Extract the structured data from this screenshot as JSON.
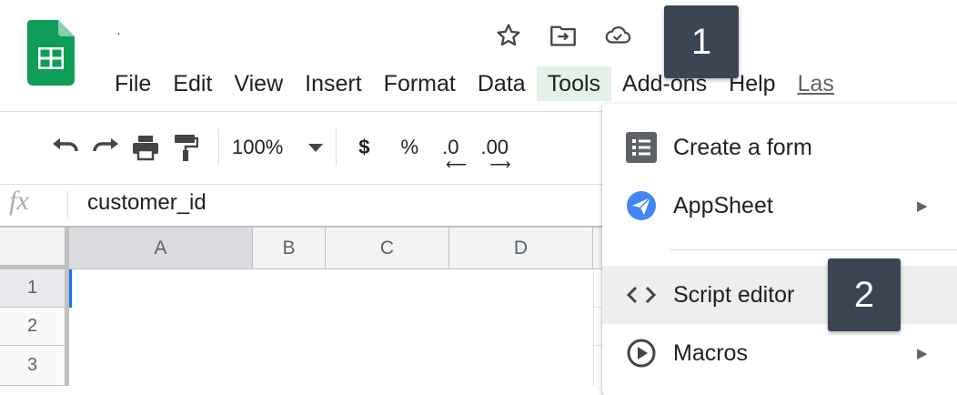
{
  "header": {
    "doc_title": "·",
    "icons": [
      "star-icon",
      "move-folder-icon",
      "cloud-saved-icon"
    ]
  },
  "menu": {
    "items": [
      {
        "label": "File"
      },
      {
        "label": "Edit"
      },
      {
        "label": "View"
      },
      {
        "label": "Insert"
      },
      {
        "label": "Format"
      },
      {
        "label": "Data"
      },
      {
        "label": "Tools",
        "active": true
      },
      {
        "label": "Add-ons"
      },
      {
        "label": "Help"
      },
      {
        "label": "Las"
      }
    ]
  },
  "toolbar": {
    "zoom": "100%",
    "currency": "$",
    "percent": "%",
    "decrease_decimals": ".0",
    "increase_decimals": ".00"
  },
  "formula_bar": {
    "fx_label": "fx",
    "value": "customer_id"
  },
  "grid": {
    "columns": [
      "A",
      "B",
      "C",
      "D"
    ],
    "rows": [
      "1",
      "2",
      "3"
    ],
    "selected_column": "A",
    "selected_row": "1"
  },
  "tools_menu": {
    "items": [
      {
        "label": "Create a form",
        "icon": "form-icon",
        "submenu": false
      },
      {
        "label": "AppSheet",
        "icon": "appsheet-icon",
        "submenu": true
      },
      {
        "label": "Script editor",
        "icon": "code-icon",
        "submenu": false,
        "highlighted": true
      },
      {
        "label": "Macros",
        "icon": "play-circle-icon",
        "submenu": true
      }
    ],
    "submenu_arrow": "▶"
  },
  "callouts": {
    "first": "1",
    "second": "2"
  },
  "colors": {
    "sheets_green": "#0f9d58",
    "active_menu_bg": "#e3f1e6",
    "callout_bg": "#3b4554",
    "appsheet_blue": "#4285f4"
  }
}
